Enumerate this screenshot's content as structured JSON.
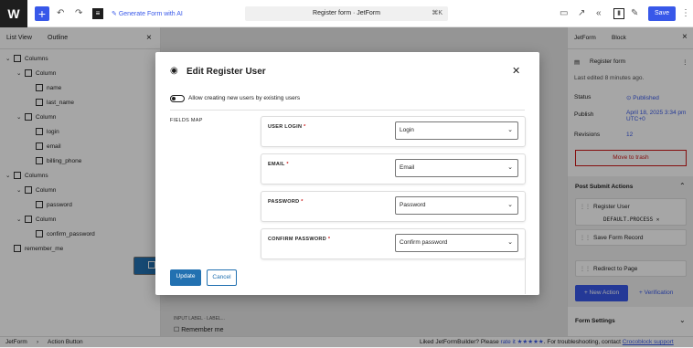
{
  "topbar": {
    "generate": "Generate Form with AI",
    "doc_title": "Register form · JetForm",
    "shortcut": "⌘K",
    "save": "Save"
  },
  "left": {
    "tab_list": "List View",
    "tab_outline": "Outline",
    "close": "×",
    "tree": [
      {
        "label": "Columns",
        "level": 0,
        "arrow": "⌄"
      },
      {
        "label": "Column",
        "level": 1,
        "arrow": "⌄"
      },
      {
        "label": "name",
        "level": 2,
        "arrow": ""
      },
      {
        "label": "last_name",
        "level": 2,
        "arrow": ""
      },
      {
        "label": "Column",
        "level": 1,
        "arrow": "⌄"
      },
      {
        "label": "login",
        "level": 2,
        "arrow": ""
      },
      {
        "label": "email",
        "level": 2,
        "arrow": ""
      },
      {
        "label": "billing_phone",
        "level": 2,
        "arrow": ""
      },
      {
        "label": "Columns",
        "level": 0,
        "arrow": "⌄"
      },
      {
        "label": "Column",
        "level": 1,
        "arrow": "⌄"
      },
      {
        "label": "password",
        "level": 2,
        "arrow": ""
      },
      {
        "label": "Column",
        "level": 1,
        "arrow": "⌄"
      },
      {
        "label": "confirm_password",
        "level": 2,
        "arrow": ""
      },
      {
        "label": "remember_me",
        "level": 0,
        "arrow": ""
      },
      {
        "label": "Action Button",
        "level": 0,
        "arrow": "",
        "selected": true
      }
    ]
  },
  "canvas": {
    "input_label": "INPUT LABEL · LABEL...",
    "remember": "Remember me"
  },
  "right": {
    "tab_form": "JetForm",
    "tab_block": "Block",
    "close": "×",
    "title": "Register form",
    "edited": "Last edited 8 minutes ago.",
    "status_label": "Status",
    "status_value": "Published",
    "publish_label": "Publish",
    "publish_value": "April 18, 2025 3:34 pm UTC+0",
    "revisions_label": "Revisions",
    "revisions_value": "12",
    "trash": "Move to trash",
    "psa": "Post Submit Actions",
    "actions": [
      {
        "name": "Register User",
        "sub": "DEFAULT.PROCESS ✕"
      },
      {
        "name": "Save Form Record",
        "sub": ""
      },
      {
        "name": "Redirect to Page",
        "sub": ""
      }
    ],
    "new_action": "+ New Action",
    "verification": "+ Verification",
    "settings": "Form Settings"
  },
  "status": {
    "crumb1": "JetForm",
    "crumb2": "Action Button",
    "liked": "Liked JetFormBuilder? Please",
    "rate": "rate it ★★★★★",
    "trouble": ". For troubleshooting, contact",
    "support": "Crocoblock support"
  },
  "modal": {
    "title": "Edit Register User",
    "close": "✕",
    "toggle_label": "Allow creating new users by existing users",
    "fields_map": "FIELDS MAP",
    "fields": [
      {
        "label": "USER LOGIN",
        "value": "Login"
      },
      {
        "label": "EMAIL",
        "value": "Email"
      },
      {
        "label": "PASSWORD",
        "value": "Password"
      },
      {
        "label": "CONFIRM PASSWORD",
        "value": "Confirm password"
      }
    ],
    "update": "Update",
    "cancel": "Cancel"
  }
}
